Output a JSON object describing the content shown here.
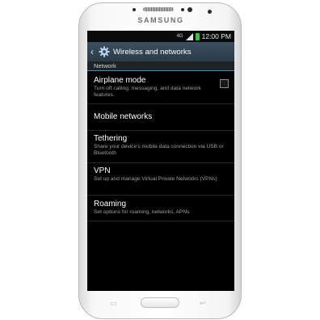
{
  "device": {
    "brand": "SAMSUNG"
  },
  "status_bar": {
    "time": "12:00 PM",
    "network": "4G"
  },
  "header": {
    "title": "Wireless and networks"
  },
  "section": {
    "label": "Network"
  },
  "items": [
    {
      "name": "Airplane mode",
      "desc": "Turn off calling, messaging, and data network features."
    },
    {
      "name": "Mobile networks",
      "desc": ""
    },
    {
      "name": "Tethering",
      "desc": "Share your device's mobile data connection via USB or Bluetooth"
    },
    {
      "name": "VPN",
      "desc": "Set up and manage Virtual Private Networks (VPNs)"
    },
    {
      "name": "Roaming",
      "desc": "Set options for roaming, networks, APNs"
    }
  ],
  "icons": {
    "back": "back-arrow-icon",
    "settings": "gear-icon",
    "signal": "signal-icon",
    "battery": "battery-icon"
  },
  "colors": {
    "title_bar": "#2f4150",
    "accent": "#4a8fb5",
    "battery": "#35c33c"
  }
}
